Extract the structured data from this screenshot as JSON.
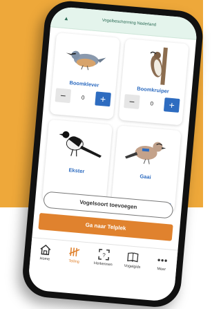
{
  "header": {
    "title": "Vogelbescherming Nederland"
  },
  "birds": [
    {
      "name": "Boomklever",
      "count": "0",
      "icon": "nuthatch-illustration"
    },
    {
      "name": "Boomkruiper",
      "count": "0",
      "icon": "treecreeper-illustration"
    },
    {
      "name": "Ekster",
      "count": "",
      "icon": "magpie-illustration"
    },
    {
      "name": "Gaai",
      "count": "",
      "icon": "jay-illustration"
    }
  ],
  "stepper": {
    "minus": "−",
    "plus": "+"
  },
  "actions": {
    "add_species": "Vogelsoort toevoegen",
    "go_to_count": "Ga naar Telplek"
  },
  "tabs": [
    {
      "label": "Home",
      "icon": "home-icon"
    },
    {
      "label": "Telling",
      "icon": "count-icon",
      "active": true
    },
    {
      "label": "Herkennen",
      "icon": "scan-icon"
    },
    {
      "label": "Vogelgids",
      "icon": "book-icon"
    },
    {
      "label": "Meer",
      "icon": "more-icon"
    }
  ],
  "colors": {
    "background": "#eea83a",
    "accent_blue": "#2e6cc0",
    "accent_orange": "#e0822e",
    "header_green": "#e4f4ec"
  }
}
